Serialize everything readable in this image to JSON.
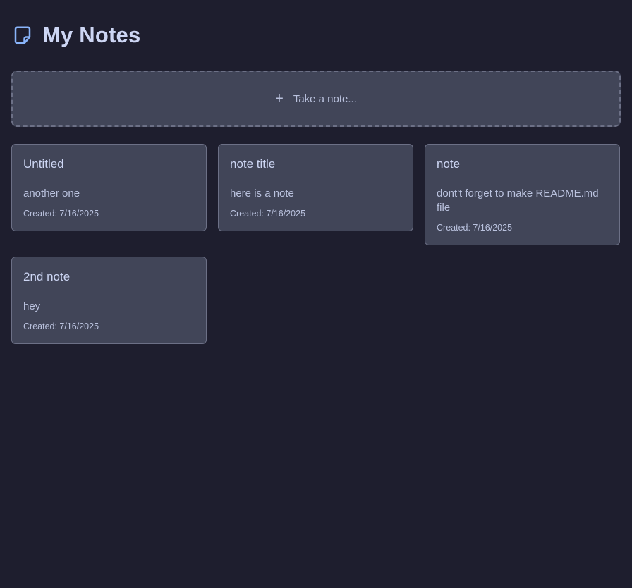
{
  "header": {
    "title": "My Notes",
    "icon": "note-icon",
    "icon_color": "#89b4fa"
  },
  "composer": {
    "icon": "plus-icon",
    "plus_glyph": "+",
    "label": "Take a note..."
  },
  "notes": [
    {
      "title": "Untitled",
      "body": "another one",
      "created": "Created: 7/16/2025"
    },
    {
      "title": "note title",
      "body": "here is a note",
      "created": "Created: 7/16/2025"
    },
    {
      "title": "note",
      "body": "dont't forget to make README.md file",
      "created": "Created: 7/16/2025"
    },
    {
      "title": "2nd note",
      "body": "hey",
      "created": "Created: 7/16/2025"
    }
  ],
  "colors": {
    "background": "#1e1e2e",
    "card": "#414558",
    "border": "#6c7086",
    "text": "#cdd6f4",
    "muted_text": "#bac2de",
    "accent": "#89b4fa"
  }
}
